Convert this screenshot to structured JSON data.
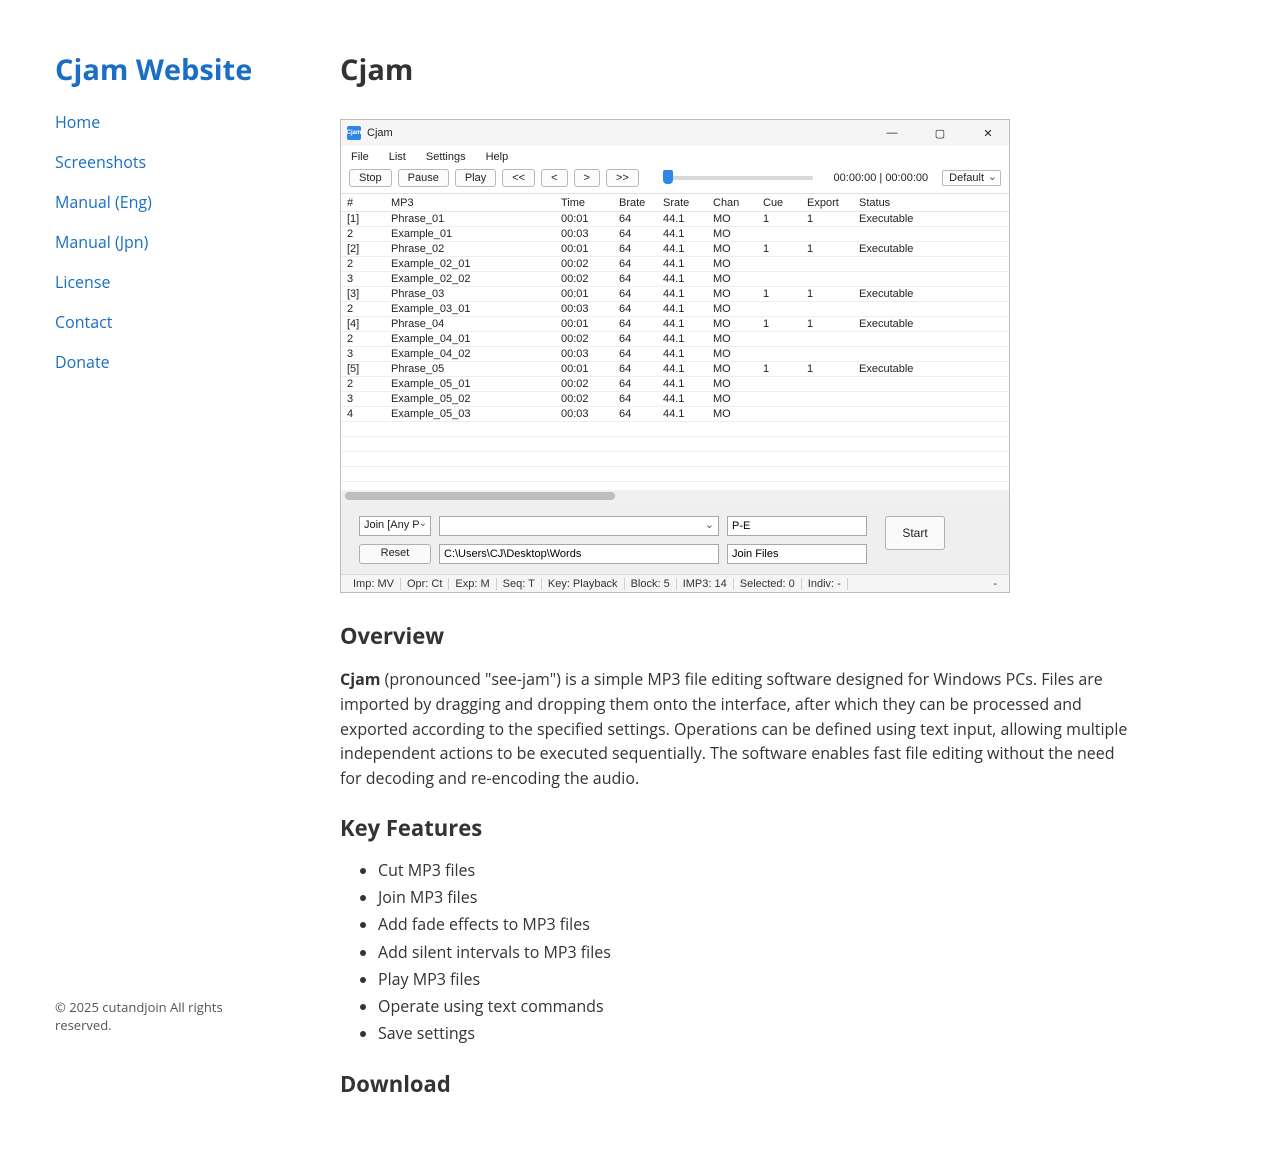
{
  "site": {
    "title": "Cjam Website"
  },
  "nav": [
    {
      "label": "Home"
    },
    {
      "label": "Screenshots"
    },
    {
      "label": "Manual (Eng)"
    },
    {
      "label": "Manual (Jpn)"
    },
    {
      "label": "License"
    },
    {
      "label": "Contact"
    },
    {
      "label": "Donate"
    }
  ],
  "copyright": "© 2025 cutandjoin All rights reserved.",
  "page": {
    "title": "Cjam"
  },
  "app": {
    "title": "Cjam",
    "menus": [
      "File",
      "List",
      "Settings",
      "Help"
    ],
    "toolbar": {
      "buttons": [
        "Stop",
        "Pause",
        "Play",
        "<<",
        "<",
        ">",
        ">>"
      ],
      "time": "00:00:00 | 00:00:00",
      "mode": "Default"
    },
    "columns": [
      "#",
      "MP3",
      "Time",
      "Brate",
      "Srate",
      "Chan",
      "Cue",
      "Export",
      "Status"
    ],
    "rows": [
      {
        "n": "[1]",
        "mp3": "Phrase_01",
        "time": "00:01",
        "br": "64",
        "sr": "44.1",
        "ch": "MO",
        "cue": "1",
        "exp": "1",
        "st": "Executable"
      },
      {
        "n": "2",
        "mp3": "Example_01",
        "time": "00:03",
        "br": "64",
        "sr": "44.1",
        "ch": "MO",
        "cue": "",
        "exp": "",
        "st": ""
      },
      {
        "n": "[2]",
        "mp3": "Phrase_02",
        "time": "00:01",
        "br": "64",
        "sr": "44.1",
        "ch": "MO",
        "cue": "1",
        "exp": "1",
        "st": "Executable"
      },
      {
        "n": "2",
        "mp3": "Example_02_01",
        "time": "00:02",
        "br": "64",
        "sr": "44.1",
        "ch": "MO",
        "cue": "",
        "exp": "",
        "st": ""
      },
      {
        "n": "3",
        "mp3": "Example_02_02",
        "time": "00:02",
        "br": "64",
        "sr": "44.1",
        "ch": "MO",
        "cue": "",
        "exp": "",
        "st": ""
      },
      {
        "n": "[3]",
        "mp3": "Phrase_03",
        "time": "00:01",
        "br": "64",
        "sr": "44.1",
        "ch": "MO",
        "cue": "1",
        "exp": "1",
        "st": "Executable"
      },
      {
        "n": "2",
        "mp3": "Example_03_01",
        "time": "00:03",
        "br": "64",
        "sr": "44.1",
        "ch": "MO",
        "cue": "",
        "exp": "",
        "st": ""
      },
      {
        "n": "[4]",
        "mp3": "Phrase_04",
        "time": "00:01",
        "br": "64",
        "sr": "44.1",
        "ch": "MO",
        "cue": "1",
        "exp": "1",
        "st": "Executable"
      },
      {
        "n": "2",
        "mp3": "Example_04_01",
        "time": "00:02",
        "br": "64",
        "sr": "44.1",
        "ch": "MO",
        "cue": "",
        "exp": "",
        "st": ""
      },
      {
        "n": "3",
        "mp3": "Example_04_02",
        "time": "00:03",
        "br": "64",
        "sr": "44.1",
        "ch": "MO",
        "cue": "",
        "exp": "",
        "st": ""
      },
      {
        "n": "[5]",
        "mp3": "Phrase_05",
        "time": "00:01",
        "br": "64",
        "sr": "44.1",
        "ch": "MO",
        "cue": "1",
        "exp": "1",
        "st": "Executable"
      },
      {
        "n": "2",
        "mp3": "Example_05_01",
        "time": "00:02",
        "br": "64",
        "sr": "44.1",
        "ch": "MO",
        "cue": "",
        "exp": "",
        "st": ""
      },
      {
        "n": "3",
        "mp3": "Example_05_02",
        "time": "00:02",
        "br": "64",
        "sr": "44.1",
        "ch": "MO",
        "cue": "",
        "exp": "",
        "st": ""
      },
      {
        "n": "4",
        "mp3": "Example_05_03",
        "time": "00:03",
        "br": "64",
        "sr": "44.1",
        "ch": "MO",
        "cue": "",
        "exp": "",
        "st": ""
      }
    ],
    "footer": {
      "joinMode": "Join [Any P",
      "reset": "Reset",
      "path": "C:\\Users\\CJ\\Desktop\\Words",
      "pe": "P-E",
      "joinFiles": "Join Files",
      "start": "Start"
    },
    "status": [
      "Imp: MV",
      "Opr: Ct",
      "Exp: M",
      "Seq: T",
      "Key: Playback",
      "Block: 5",
      "IMP3: 14",
      "Selected: 0",
      "Indiv: -",
      "-"
    ]
  },
  "overview": {
    "heading": "Overview",
    "strong": "Cjam",
    "rest": " (pronounced \"see-jam\") is a simple MP3 file editing software designed for Windows PCs. Files are imported by dragging and dropping them onto the interface, after which they can be processed and exported according to the specified settings. Operations can be defined using text input, allowing multiple independent actions to be executed sequentially. The software enables fast file editing without the need for decoding and re-encoding the audio."
  },
  "features": {
    "heading": "Key Features",
    "items": [
      "Cut MP3 files",
      "Join MP3 files",
      "Add fade effects to MP3 files",
      "Add silent intervals to MP3 files",
      "Play MP3 files",
      "Operate using text commands",
      "Save settings"
    ]
  },
  "download": {
    "heading": "Download"
  }
}
